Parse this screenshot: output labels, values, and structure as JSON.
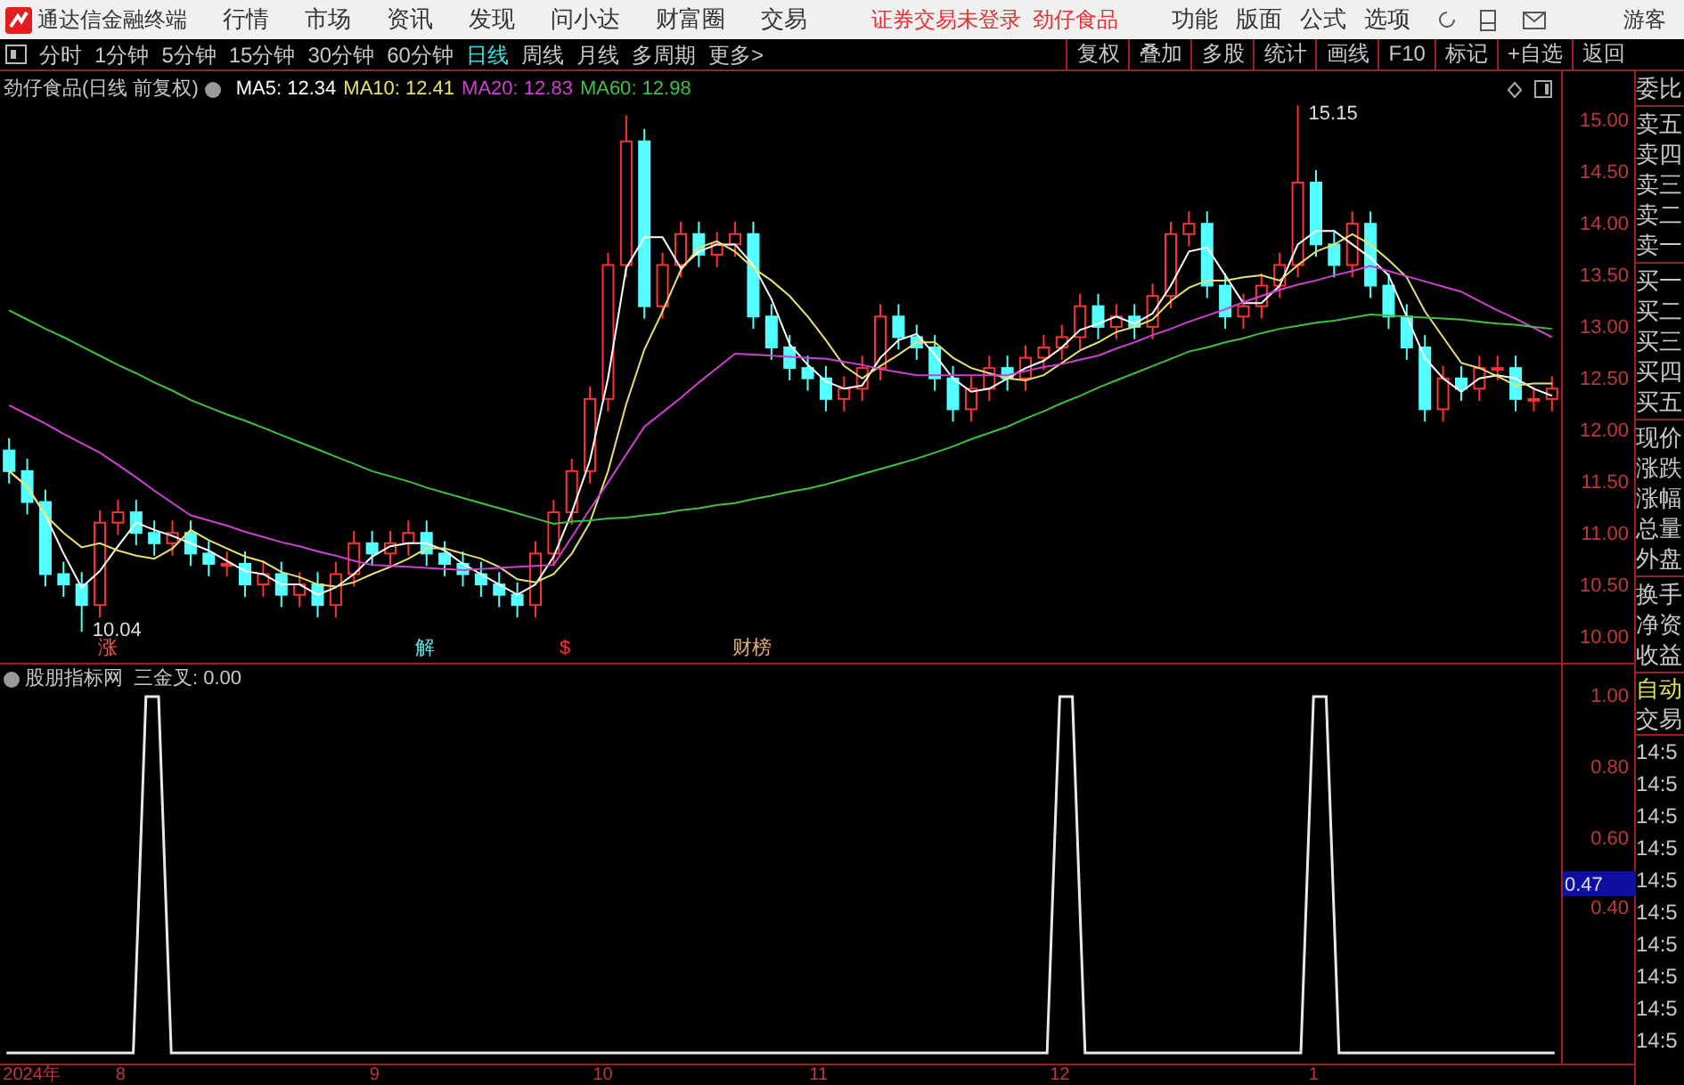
{
  "app": {
    "title": "通达信金融终端"
  },
  "menu": [
    "行情",
    "市场",
    "资讯",
    "发现",
    "问小达",
    "财富圈",
    "交易"
  ],
  "login_status": "证券交易未登录  劲仔食品",
  "right_menu": [
    "功能",
    "版面",
    "公式",
    "选项"
  ],
  "user": "游客",
  "periods": [
    {
      "label": "分时",
      "selected": false
    },
    {
      "label": "1分钟",
      "selected": false
    },
    {
      "label": "5分钟",
      "selected": false
    },
    {
      "label": "15分钟",
      "selected": false
    },
    {
      "label": "30分钟",
      "selected": false
    },
    {
      "label": "60分钟",
      "selected": false
    },
    {
      "label": "日线",
      "selected": true
    },
    {
      "label": "周线",
      "selected": false
    },
    {
      "label": "月线",
      "selected": false
    },
    {
      "label": "多周期",
      "selected": false
    },
    {
      "label": "更多>",
      "selected": false
    }
  ],
  "tools": [
    "复权",
    "叠加",
    "多股",
    "统计",
    "画线",
    "F10",
    "标记",
    "+自选",
    "返回"
  ],
  "price_chart": {
    "title": "劲仔食品(日线 前复权)",
    "legend_values": [
      ": 12.34",
      ": 12.41",
      ": 12.83",
      ": 12.98"
    ],
    "high_label": "15.15",
    "low_label": "10.04",
    "markers": [
      {
        "text": "涨",
        "color": "#ff5050"
      },
      {
        "text": "解",
        "color": "#60e0e0"
      },
      {
        "text": "$",
        "color": "#ff3030"
      },
      {
        "text": "财榜",
        "color": "#e0b070"
      }
    ],
    "chart_data": {
      "type": "candlestick",
      "categories": [
        null,
        null,
        null,
        null,
        null,
        null,
        null,
        null,
        null,
        null,
        null,
        null,
        null,
        null,
        null,
        null,
        null,
        null,
        null,
        null,
        null,
        null,
        null,
        null,
        null,
        null,
        null,
        null,
        null,
        null,
        null,
        null,
        null,
        null,
        null,
        null,
        null,
        null,
        null,
        null,
        null,
        null,
        null,
        null,
        null,
        null,
        null,
        null,
        null,
        null,
        null,
        null,
        null,
        null,
        null,
        null,
        null,
        null,
        null,
        null,
        null,
        null,
        null,
        null,
        null,
        null,
        null,
        null,
        null,
        null,
        null,
        null,
        null,
        null,
        null,
        null,
        null,
        null,
        null,
        null,
        null,
        null,
        null,
        null,
        null,
        null
      ],
      "ohlc": [
        [
          11.8,
          11.92,
          11.48,
          11.6
        ],
        [
          11.6,
          11.72,
          11.18,
          11.3
        ],
        [
          11.3,
          11.42,
          10.48,
          10.6
        ],
        [
          10.6,
          10.72,
          10.38,
          10.5
        ],
        [
          10.5,
          10.62,
          10.04,
          10.3
        ],
        [
          10.3,
          11.22,
          10.18,
          11.1
        ],
        [
          11.1,
          11.32,
          10.98,
          11.2
        ],
        [
          11.2,
          11.32,
          10.88,
          11.0
        ],
        [
          11.0,
          11.12,
          10.78,
          10.9
        ],
        [
          10.9,
          11.12,
          10.78,
          11.0
        ],
        [
          11.0,
          11.12,
          10.68,
          10.8
        ],
        [
          10.8,
          10.92,
          10.58,
          10.7
        ],
        [
          10.7,
          10.82,
          10.58,
          10.7
        ],
        [
          10.7,
          10.82,
          10.38,
          10.5
        ],
        [
          10.5,
          10.72,
          10.38,
          10.6
        ],
        [
          10.6,
          10.72,
          10.28,
          10.4
        ],
        [
          10.4,
          10.62,
          10.28,
          10.5
        ],
        [
          10.5,
          10.62,
          10.18,
          10.3
        ],
        [
          10.3,
          10.72,
          10.18,
          10.6
        ],
        [
          10.6,
          11.02,
          10.48,
          10.9
        ],
        [
          10.9,
          11.02,
          10.68,
          10.8
        ],
        [
          10.8,
          11.02,
          10.68,
          10.9
        ],
        [
          10.9,
          11.12,
          10.78,
          11.0
        ],
        [
          11.0,
          11.12,
          10.68,
          10.8
        ],
        [
          10.8,
          10.92,
          10.58,
          10.7
        ],
        [
          10.7,
          10.82,
          10.48,
          10.6
        ],
        [
          10.6,
          10.72,
          10.38,
          10.5
        ],
        [
          10.5,
          10.62,
          10.28,
          10.4
        ],
        [
          10.4,
          10.52,
          10.18,
          10.3
        ],
        [
          10.3,
          10.92,
          10.18,
          10.8
        ],
        [
          10.8,
          11.32,
          10.68,
          11.2
        ],
        [
          11.2,
          11.72,
          11.08,
          11.6
        ],
        [
          11.6,
          12.42,
          11.48,
          12.3
        ],
        [
          12.3,
          13.72,
          12.18,
          13.6
        ],
        [
          13.6,
          15.05,
          13.48,
          14.8
        ],
        [
          14.8,
          14.92,
          13.08,
          13.2
        ],
        [
          13.2,
          13.72,
          13.08,
          13.6
        ],
        [
          13.6,
          14.02,
          13.48,
          13.9
        ],
        [
          13.9,
          14.02,
          13.58,
          13.7
        ],
        [
          13.7,
          13.92,
          13.58,
          13.8
        ],
        [
          13.8,
          14.02,
          13.68,
          13.9
        ],
        [
          13.9,
          14.02,
          12.98,
          13.1
        ],
        [
          13.1,
          13.22,
          12.68,
          12.8
        ],
        [
          12.8,
          12.92,
          12.48,
          12.6
        ],
        [
          12.6,
          12.72,
          12.38,
          12.5
        ],
        [
          12.5,
          12.62,
          12.18,
          12.3
        ],
        [
          12.3,
          12.52,
          12.18,
          12.4
        ],
        [
          12.4,
          12.72,
          12.28,
          12.6
        ],
        [
          12.6,
          13.22,
          12.48,
          13.1
        ],
        [
          13.1,
          13.22,
          12.78,
          12.9
        ],
        [
          12.9,
          13.02,
          12.68,
          12.8
        ],
        [
          12.8,
          12.92,
          12.38,
          12.5
        ],
        [
          12.5,
          12.62,
          12.08,
          12.2
        ],
        [
          12.2,
          12.52,
          12.08,
          12.4
        ],
        [
          12.4,
          12.72,
          12.28,
          12.6
        ],
        [
          12.6,
          12.72,
          12.38,
          12.5
        ],
        [
          12.5,
          12.82,
          12.38,
          12.7
        ],
        [
          12.7,
          12.92,
          12.58,
          12.8
        ],
        [
          12.8,
          13.02,
          12.68,
          12.9
        ],
        [
          12.9,
          13.32,
          12.78,
          13.2
        ],
        [
          13.2,
          13.32,
          12.88,
          13.0
        ],
        [
          13.0,
          13.22,
          12.88,
          13.1
        ],
        [
          13.1,
          13.22,
          12.88,
          13.0
        ],
        [
          13.0,
          13.42,
          12.88,
          13.3
        ],
        [
          13.3,
          14.02,
          13.18,
          13.9
        ],
        [
          13.9,
          14.12,
          13.78,
          14.0
        ],
        [
          14.0,
          14.12,
          13.28,
          13.4
        ],
        [
          13.4,
          13.52,
          12.98,
          13.1
        ],
        [
          13.1,
          13.32,
          12.98,
          13.2
        ],
        [
          13.2,
          13.52,
          13.08,
          13.4
        ],
        [
          13.4,
          13.72,
          13.28,
          13.6
        ],
        [
          13.6,
          15.15,
          13.48,
          14.4
        ],
        [
          14.4,
          14.52,
          13.68,
          13.8
        ],
        [
          13.8,
          13.92,
          13.48,
          13.6
        ],
        [
          13.6,
          14.12,
          13.48,
          14.0
        ],
        [
          14.0,
          14.12,
          13.28,
          13.4
        ],
        [
          13.4,
          13.52,
          12.98,
          13.1
        ],
        [
          13.1,
          13.22,
          12.68,
          12.8
        ],
        [
          12.8,
          12.92,
          12.08,
          12.2
        ],
        [
          12.2,
          12.62,
          12.08,
          12.5
        ],
        [
          12.5,
          12.62,
          12.28,
          12.4
        ],
        [
          12.4,
          12.72,
          12.28,
          12.6
        ],
        [
          12.6,
          12.72,
          12.48,
          12.6
        ],
        [
          12.6,
          12.72,
          12.18,
          12.3
        ],
        [
          12.3,
          12.42,
          12.18,
          12.3
        ],
        [
          12.3,
          12.52,
          12.18,
          12.4
        ]
      ],
      "series": [
        {
          "name": "MA5",
          "type": "line",
          "color": "#ffffff",
          "values": [
            11.6,
            11.45,
            11.17,
            10.8,
            10.47,
            10.63,
            10.87,
            11.1,
            11.03,
            10.97,
            10.9,
            10.83,
            10.73,
            10.63,
            10.6,
            10.5,
            10.5,
            10.4,
            10.47,
            10.6,
            10.77,
            10.87,
            10.9,
            10.9,
            10.83,
            10.7,
            10.6,
            10.5,
            10.4,
            10.5,
            10.77,
            11.2,
            11.7,
            12.5,
            13.57,
            13.87,
            13.87,
            13.57,
            13.73,
            13.8,
            13.8,
            13.6,
            13.27,
            12.83,
            12.63,
            12.47,
            12.4,
            12.43,
            12.7,
            12.87,
            12.93,
            12.73,
            12.5,
            12.37,
            12.4,
            12.5,
            12.6,
            12.67,
            12.8,
            12.97,
            13.03,
            13.1,
            13.03,
            13.13,
            13.4,
            13.73,
            13.77,
            13.5,
            13.23,
            13.23,
            13.4,
            13.8,
            13.93,
            13.93,
            13.8,
            13.67,
            13.5,
            13.1,
            12.7,
            12.5,
            12.37,
            12.5,
            12.53,
            12.5,
            12.4,
            12.33
          ]
        },
        {
          "name": "MA10",
          "type": "line",
          "color": "#e8e070",
          "values": [
            11.6,
            11.45,
            11.17,
            11.0,
            10.86,
            10.9,
            10.83,
            10.78,
            10.75,
            10.85,
            11.03,
            10.93,
            10.85,
            10.77,
            10.72,
            10.62,
            10.57,
            10.5,
            10.48,
            10.52,
            10.6,
            10.67,
            10.75,
            10.85,
            10.85,
            10.8,
            10.75,
            10.67,
            10.55,
            10.52,
            10.6,
            10.8,
            11.1,
            11.6,
            12.25,
            12.78,
            13.15,
            13.55,
            13.77,
            13.83,
            13.73,
            13.57,
            13.45,
            13.3,
            13.1,
            12.87,
            12.62,
            12.5,
            12.62,
            12.73,
            12.85,
            12.85,
            12.7,
            12.6,
            12.55,
            12.5,
            12.48,
            12.53,
            12.65,
            12.77,
            12.85,
            12.95,
            13.0,
            13.07,
            13.25,
            13.38,
            13.45,
            13.45,
            13.48,
            13.5,
            13.45,
            13.6,
            13.73,
            13.8,
            13.9,
            13.8,
            13.65,
            13.48,
            13.15,
            12.9,
            12.65,
            12.6,
            12.52,
            12.43,
            12.45,
            12.45
          ]
        },
        {
          "name": "MA20",
          "type": "line",
          "color": "#d040d0",
          "values": [
            12.24,
            12.15,
            12.06,
            11.96,
            11.87,
            11.78,
            11.66,
            11.54,
            11.41,
            11.29,
            11.17,
            11.12,
            11.07,
            11.01,
            10.96,
            10.91,
            10.87,
            10.82,
            10.78,
            10.73,
            10.69,
            10.68,
            10.67,
            10.66,
            10.65,
            10.64,
            10.65,
            10.66,
            10.67,
            10.68,
            10.69,
            10.96,
            11.23,
            11.49,
            11.76,
            12.03,
            12.17,
            12.31,
            12.46,
            12.6,
            12.74,
            12.73,
            12.72,
            12.71,
            12.7,
            12.69,
            12.66,
            12.63,
            12.59,
            12.56,
            12.53,
            12.53,
            12.53,
            12.53,
            12.53,
            12.53,
            12.57,
            12.61,
            12.64,
            12.68,
            12.72,
            12.79,
            12.85,
            12.92,
            12.98,
            13.05,
            13.11,
            13.17,
            13.24,
            13.3,
            13.36,
            13.41,
            13.45,
            13.5,
            13.54,
            13.59,
            13.54,
            13.49,
            13.44,
            13.39,
            13.34,
            13.25,
            13.16,
            13.08,
            12.99,
            12.9
          ]
        },
        {
          "name": "MA60",
          "type": "line",
          "color": "#40c040",
          "values": [
            13.16,
            13.07,
            12.98,
            12.9,
            12.81,
            12.72,
            12.63,
            12.55,
            12.46,
            12.38,
            12.29,
            12.22,
            12.15,
            12.09,
            12.02,
            11.95,
            11.88,
            11.81,
            11.74,
            11.67,
            11.6,
            11.55,
            11.5,
            11.44,
            11.39,
            11.34,
            11.29,
            11.24,
            11.19,
            11.14,
            11.09,
            11.11,
            11.12,
            11.14,
            11.15,
            11.17,
            11.19,
            11.22,
            11.24,
            11.27,
            11.29,
            11.33,
            11.36,
            11.4,
            11.43,
            11.47,
            11.52,
            11.57,
            11.62,
            11.67,
            11.72,
            11.78,
            11.84,
            11.91,
            11.97,
            12.03,
            12.11,
            12.18,
            12.26,
            12.33,
            12.41,
            12.48,
            12.55,
            12.62,
            12.69,
            12.76,
            12.8,
            12.85,
            12.89,
            12.94,
            12.98,
            13.01,
            13.04,
            13.06,
            13.09,
            13.12,
            13.11,
            13.1,
            13.09,
            13.08,
            13.07,
            13.05,
            13.03,
            13.02,
            13.0,
            12.98
          ]
        }
      ],
      "ylim": [
        9.74,
        15.48
      ],
      "yticks": [
        {
          "value": 15,
          "label": "15.00"
        },
        {
          "value": 14.5,
          "label": "14.50"
        },
        {
          "value": 14,
          "label": "14.00"
        },
        {
          "value": 13.5,
          "label": "13.50"
        },
        {
          "value": 13,
          "label": "13.00"
        },
        {
          "value": 12.5,
          "label": "12.50"
        },
        {
          "value": 12,
          "label": "12.00"
        },
        {
          "value": 11.5,
          "label": "11.50"
        },
        {
          "value": 11,
          "label": "11.00"
        },
        {
          "value": 10.5,
          "label": "10.50"
        },
        {
          "value": 10,
          "label": "10.00"
        }
      ]
    }
  },
  "indicator": {
    "title": "股朋指标网",
    "legend_value": ": 0.00",
    "cursor_value": "0.47",
    "chart_data": {
      "type": "line",
      "categories": [
        null,
        null,
        "2024年",
        null,
        null,
        null,
        null,
        null,
        null,
        "8",
        null,
        null,
        null,
        null,
        null,
        null,
        null,
        null,
        null,
        null,
        null,
        null,
        null,
        null,
        null,
        null,
        null,
        null,
        null,
        "9",
        null,
        null,
        null,
        null,
        null,
        null,
        null,
        null,
        null,
        null,
        null,
        null,
        null,
        null,
        null,
        null,
        null,
        "10",
        null,
        null,
        null,
        null,
        null,
        null,
        null,
        null,
        null,
        null,
        null,
        null,
        null,
        null,
        null,
        null,
        "11",
        null,
        null,
        null,
        null,
        null,
        null,
        null,
        null,
        null,
        null,
        null,
        null,
        null,
        null,
        null,
        null,
        null,
        null,
        "12",
        null,
        null,
        null,
        null,
        null,
        null,
        null,
        null,
        null,
        null,
        null,
        null,
        null,
        null,
        null,
        null,
        null,
        null,
        null,
        "1",
        null,
        null,
        null,
        null,
        null,
        null,
        null,
        null,
        null,
        null,
        null,
        null,
        null,
        null,
        null,
        null,
        null,
        null,
        null
      ],
      "series": [
        {
          "name": "三金叉",
          "color": "#e8e8e8",
          "values": [
            0,
            0,
            0,
            0,
            0,
            0,
            0,
            0,
            0,
            0,
            0,
            1,
            1,
            0,
            0,
            0,
            0,
            0,
            0,
            0,
            0,
            0,
            0,
            0,
            0,
            0,
            0,
            0,
            0,
            0,
            0,
            0,
            0,
            0,
            0,
            0,
            0,
            0,
            0,
            0,
            0,
            0,
            0,
            0,
            0,
            0,
            0,
            0,
            0,
            0,
            0,
            0,
            0,
            0,
            0,
            0,
            0,
            0,
            0,
            0,
            0,
            0,
            0,
            0,
            0,
            0,
            0,
            0,
            0,
            0,
            0,
            0,
            0,
            0,
            0,
            0,
            0,
            0,
            0,
            0,
            0,
            0,
            0,
            1,
            1,
            0,
            0,
            0,
            0,
            0,
            0,
            0,
            0,
            0,
            0,
            0,
            0,
            0,
            0,
            0,
            0,
            0,
            0,
            1,
            1,
            0,
            0,
            0,
            0,
            0,
            0,
            0,
            0,
            0,
            0,
            0,
            0,
            0,
            0,
            0,
            0,
            0,
            0
          ]
        }
      ],
      "ylim": [
        -0.03,
        1.09
      ],
      "yticks": [
        {
          "value": 1,
          "label": "1.00"
        },
        {
          "value": 0.8,
          "label": "0.80"
        },
        {
          "value": 0.6,
          "label": "0.60"
        },
        {
          "value": 0.4,
          "label": "0.40"
        }
      ]
    }
  },
  "quote_panel": {
    "sections": [
      [
        "委比"
      ],
      [
        "卖五",
        "卖四",
        "卖三",
        "卖二",
        "卖一"
      ],
      [
        "买一",
        "买二",
        "买三",
        "买四",
        "买五"
      ],
      [
        "现价",
        "涨跌",
        "涨幅",
        "总量",
        "外盘"
      ],
      [
        "换手",
        "净资",
        "收益"
      ]
    ],
    "mode": "自动",
    "trade_label": "交易",
    "ticks": [
      "14:5",
      "14:5",
      "14:5",
      "14:5",
      "14:5",
      "14:5",
      "14:5",
      "14:5",
      "14:5",
      "14:5"
    ]
  }
}
